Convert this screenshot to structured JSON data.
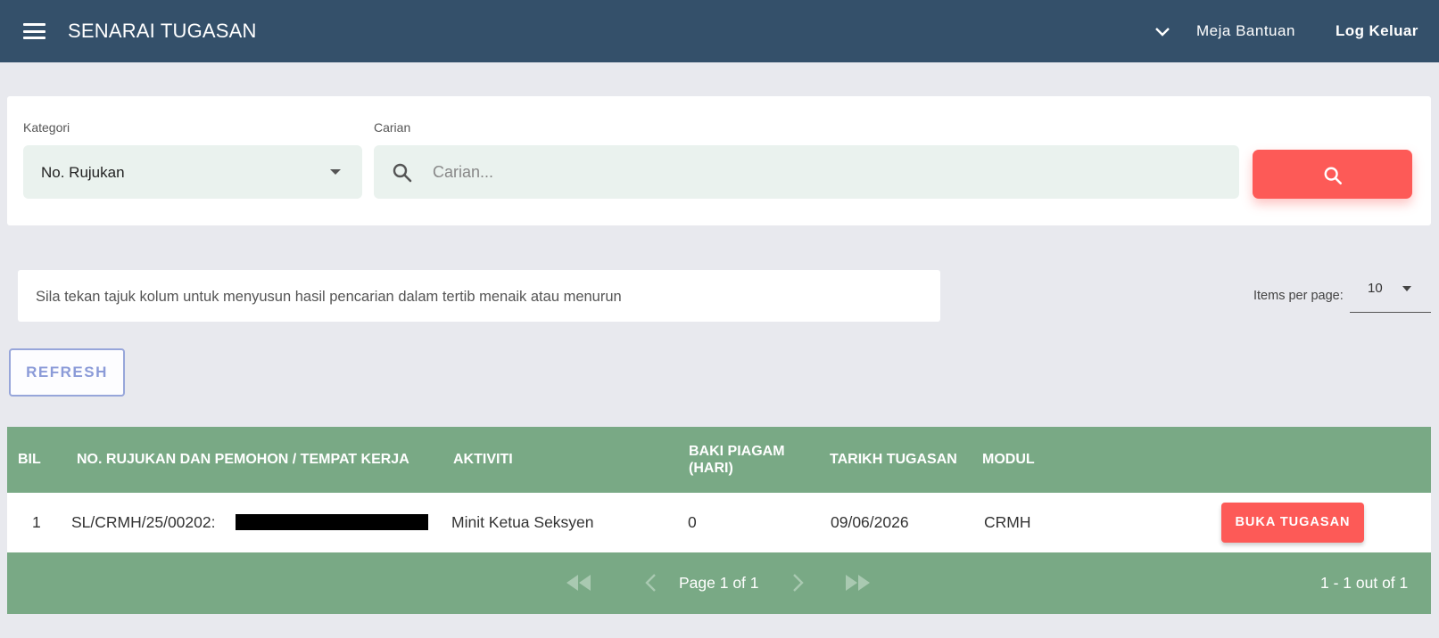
{
  "header": {
    "title": "SENARAI TUGASAN",
    "help_label": "Meja Bantuan",
    "logout_label": "Log Keluar",
    "bg_color": "#34506a"
  },
  "search": {
    "category_label": "Kategori",
    "category_value": "No. Rujukan",
    "search_label": "Carian",
    "search_placeholder": "Carian...",
    "search_value": "",
    "button_color": "#fd5a57"
  },
  "info": {
    "text": "Sila tekan tajuk kolum untuk menyusun hasil pencarian dalam tertib menaik atau menurun"
  },
  "pagination_size": {
    "label": "Items per page:",
    "value": "10"
  },
  "refresh_label": "REFRESH",
  "table": {
    "header_color": "#79a985",
    "columns": [
      "BIL",
      "NO. RUJUKAN DAN PEMOHON / TEMPAT KERJA",
      "AKTIVITI",
      "BAKI PIAGAM (HARI)",
      "TARIKH TUGASAN",
      "MODUL"
    ],
    "rows": [
      {
        "bil": "1",
        "reference": "SL/CRMH/25/00202:",
        "activity": "Minit Ketua Seksyen",
        "baki": "0",
        "date": "09/06/2026",
        "module": "CRMH",
        "action_label": "BUKA TUGASAN"
      }
    ]
  },
  "footer": {
    "page_text": "Page 1 of 1",
    "range_text": "1 - 1 out of 1"
  }
}
